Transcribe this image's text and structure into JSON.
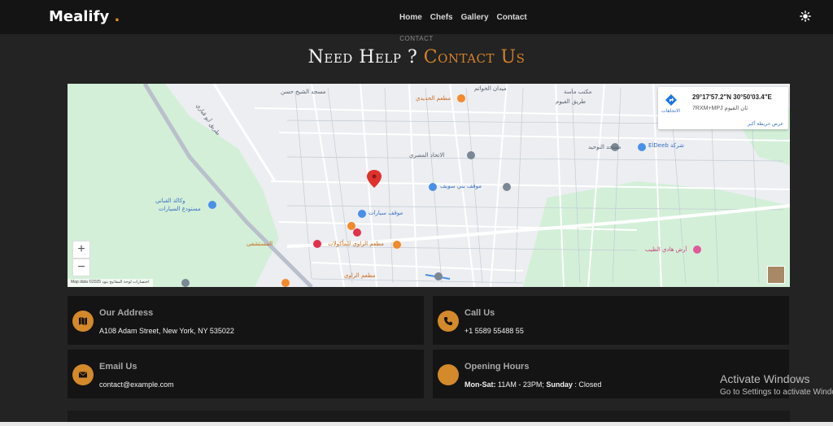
{
  "brand": {
    "name": "Mealify",
    "dot": "."
  },
  "nav": {
    "items": [
      "Home",
      "Chefs",
      "Gallery",
      "Contact"
    ]
  },
  "theme_toggle_icon": "sun-icon",
  "section": {
    "eyebrow": "CONTACT",
    "title_main": "Need Help ?",
    "title_accent": "Contact Us"
  },
  "map": {
    "coords": "29°17'57.2\"N 30°50'03.4\"E",
    "plus_code": "7RXM+MPJ ثان الفيوم",
    "directions_label": "الاتجاهات",
    "larger_map_label": "عرض خريطة أكبر",
    "zoom_in": "+",
    "zoom_out": "−",
    "footer": "Map data ©2025   اختصارات لوحة المفاتيح   بنود",
    "labels": {
      "mosque_sheikh_hassan": "مسجد الشيخ حسن",
      "hadidi_restaurant": "مطعم الحديدي",
      "khawatem_square": "ميدان الخواتم",
      "abo_qabbari": "طريق أبو قباري",
      "manor_mall": "مكتب ماسة",
      "fayoum_road": "طريق الفيوم",
      "eldeeb": "ElDeeb شركة",
      "beni_suef": "موقف بني سويف",
      "tawheed_mosque": "مسجد التوحيد",
      "hasseb_restaurant": "مطعم الراوي",
      "hospital": "المستشفى",
      "park": "أرض هادي الطيب",
      "itihad": "الاتحاد المصري",
      "parking": "موقف سيارات",
      "qaser": "مطعم الزاوي للمأكولات",
      "car_dealer": "وكالة القباني",
      "cars": "مستودع السيارات"
    }
  },
  "cards": [
    {
      "title": "Our Address",
      "text": "A108 Adam Street, New York, NY 535022",
      "icon": "map-icon"
    },
    {
      "title": "Call Us",
      "text": "+1 5589 55488 55",
      "icon": "phone-icon"
    },
    {
      "title": "Email Us",
      "text": "contact@example.com",
      "icon": "envelope-icon"
    },
    {
      "title": "Opening Hours",
      "hours_label_weekday": "Mon-Sat:",
      "hours_weekday": " 11AM - 23PM;",
      "hours_label_sunday": " Sunday",
      "hours_sunday": " : Closed",
      "icon": "clock-icon"
    }
  ],
  "watermark": {
    "title": "Activate Windows",
    "subtitle": "Go to Settings to activate Windows."
  },
  "colors": {
    "accent": "#d4892a",
    "background": "#232323",
    "navbar": "#141414",
    "card": "#141414"
  }
}
